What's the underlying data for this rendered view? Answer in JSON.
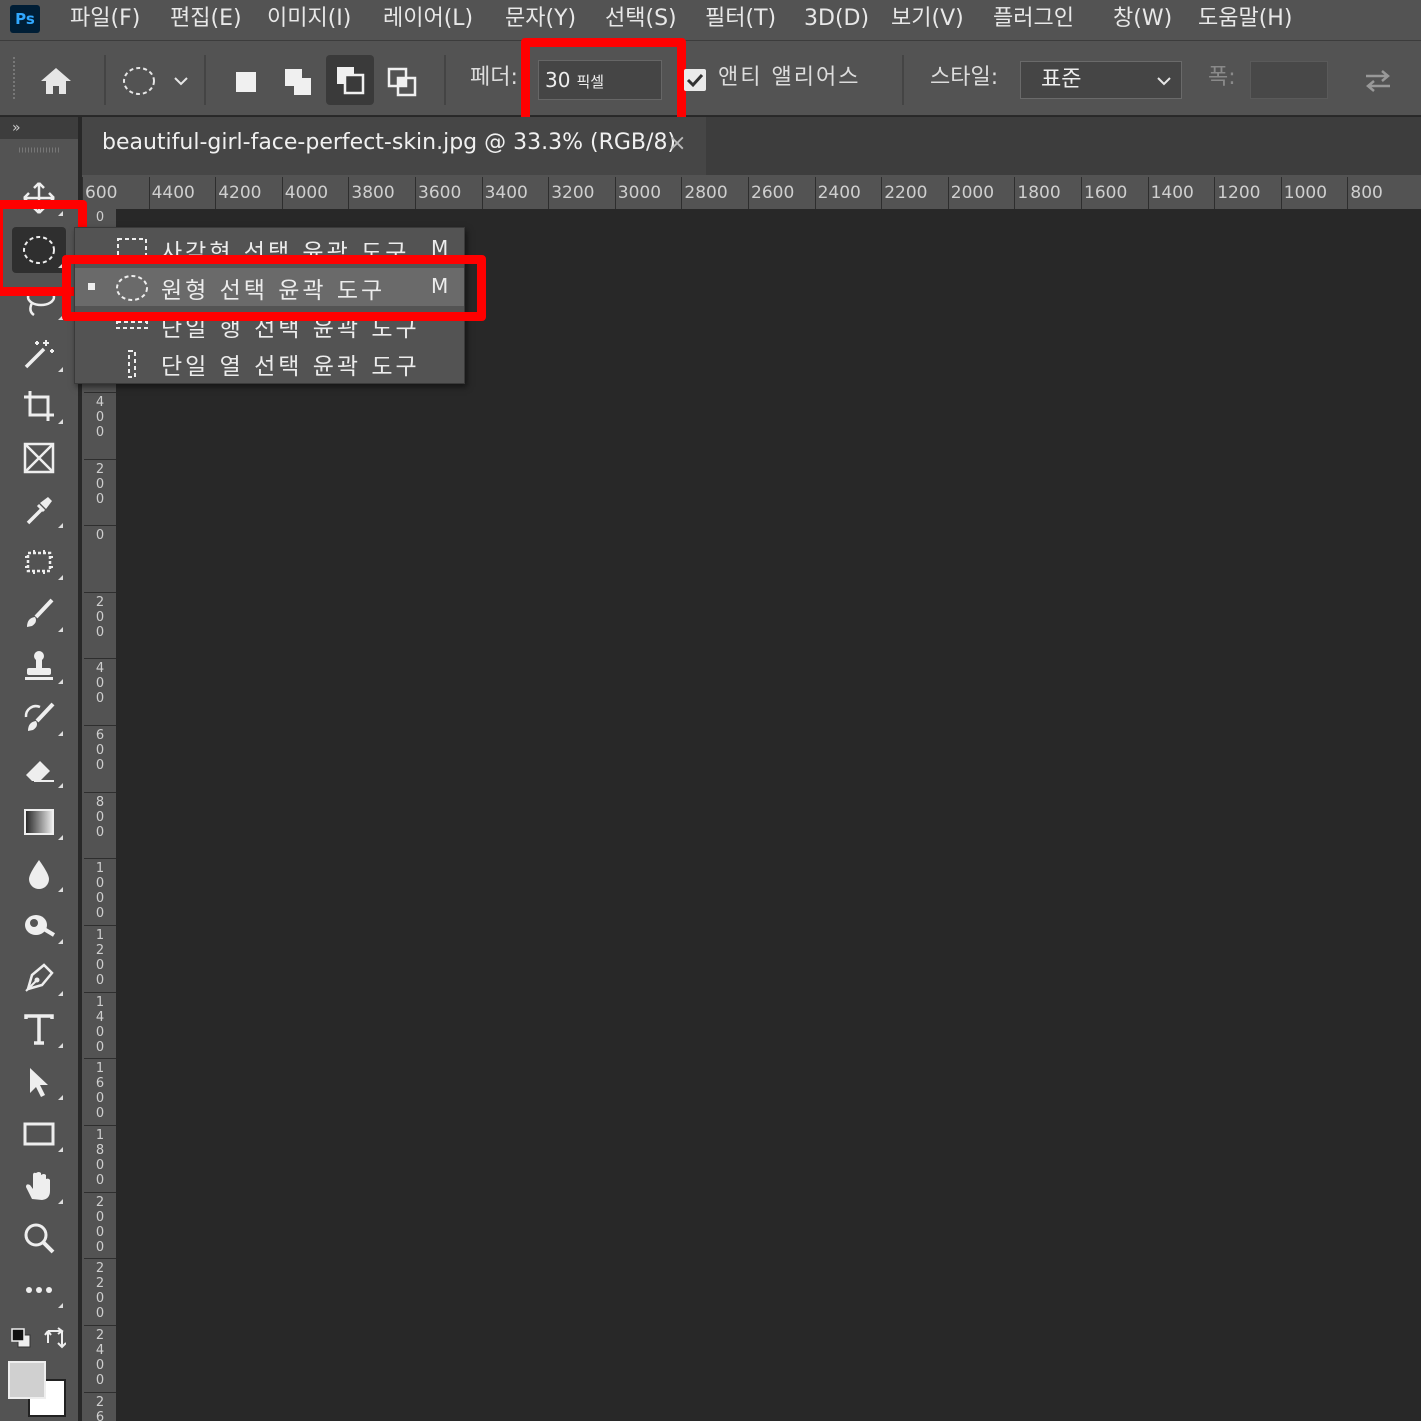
{
  "menubar": {
    "logo": "Ps",
    "items": [
      "파일(F)",
      "편집(E)",
      "이미지(I)",
      "레이어(L)",
      "문자(Y)",
      "선택(S)",
      "필터(T)",
      "3D(D)",
      "보기(V)",
      "플러그인",
      "창(W)",
      "도움말(H)"
    ]
  },
  "options": {
    "feather_label": "페더:",
    "feather_value": "30",
    "feather_unit": "픽셀",
    "antialias_label": "앤티 앨리어스",
    "antialias_checked": true,
    "style_label": "스타일:",
    "style_value": "표준",
    "width_label": "폭:",
    "width_value": ""
  },
  "toolbar": {
    "expand": "»",
    "tools": [
      "move-tool",
      "elliptical-marquee-tool",
      "lasso-tool",
      "magic-wand-tool",
      "crop-tool",
      "frame-tool",
      "eyedropper-tool",
      "object-selection-tool",
      "brush-tool",
      "clone-stamp-tool",
      "history-brush-tool",
      "eraser-tool",
      "gradient-tool",
      "blur-tool",
      "smudge-tool",
      "pen-tool",
      "type-tool",
      "path-selection-tool",
      "rectangle-tool",
      "hand-tool",
      "zoom-tool",
      "more-tools"
    ]
  },
  "document": {
    "tab_title": "beautiful-girl-face-perfect-skin.jpg @ 33.3% (RGB/8)",
    "close": "×"
  },
  "ruler_top": [
    "600",
    "4400",
    "4200",
    "4000",
    "3800",
    "3600",
    "3400",
    "3200",
    "3000",
    "2800",
    "2600",
    "2400",
    "2200",
    "2000",
    "1800",
    "1600",
    "1400",
    "1200",
    "1000",
    "800"
  ],
  "ruler_left": [
    "0",
    "400",
    "200",
    "0",
    "200",
    "400",
    "600",
    "800",
    "1000",
    "1200",
    "1400",
    "1600",
    "1800",
    "2000",
    "2200",
    "2400",
    "26"
  ],
  "flyout": {
    "items": [
      {
        "label": "사각형 선택 윤곽 도구",
        "key": "M",
        "icon": "rect-marquee-icon",
        "active": false
      },
      {
        "label": "원형 선택 윤곽 도구",
        "key": "M",
        "icon": "ellipse-marquee-icon",
        "active": true
      },
      {
        "label": "단일 행 선택 윤곽 도구",
        "key": "",
        "icon": "single-row-marquee-icon",
        "active": false
      },
      {
        "label": "단일 열 선택 윤곽 도구",
        "key": "",
        "icon": "single-col-marquee-icon",
        "active": false
      }
    ]
  },
  "colors": {
    "highlight": "#ff0000",
    "foreground": "#d0d0d0",
    "background": "#ffffff"
  }
}
